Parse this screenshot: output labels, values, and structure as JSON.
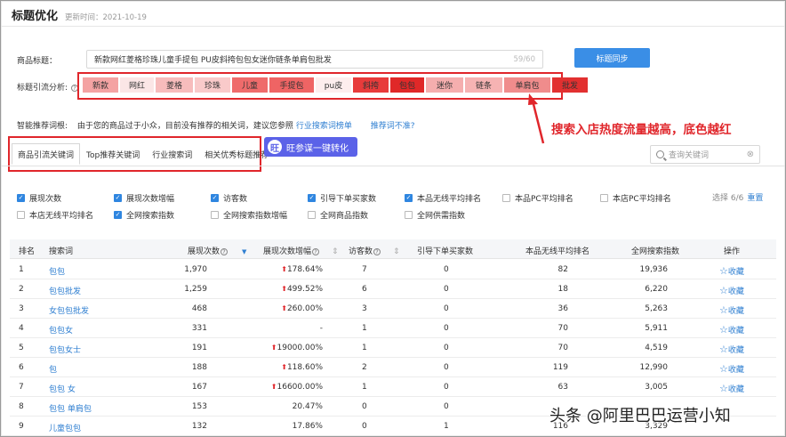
{
  "header": {
    "title": "标题优化",
    "updated": "更新时间：2021-10-19"
  },
  "title_row": {
    "label": "商品标题：",
    "value": "新款网红菱格珍珠儿童手提包 PU皮斜挎包包女迷你链条单肩包批发",
    "count": "59/60",
    "sync_button": "标题同步"
  },
  "traffic": {
    "label": "标题引流分析:",
    "help_icon": "question-circle-icon",
    "tokens": [
      {
        "text": "新款",
        "color": "#f4a3a3"
      },
      {
        "text": "网红",
        "color": "#fbe6e6"
      },
      {
        "text": "菱格",
        "color": "#f7bcbc"
      },
      {
        "text": "珍珠",
        "color": "#f9caca"
      },
      {
        "text": "儿童",
        "color": "#ef6b6b"
      },
      {
        "text": "手提包",
        "color": "#ef6464"
      },
      {
        "text": "pu皮",
        "color": "#fdeeee"
      },
      {
        "text": "斜挎",
        "color": "#e83b3b"
      },
      {
        "text": "包包",
        "color": "#e02828"
      },
      {
        "text": "迷你",
        "color": "#f5aeae"
      },
      {
        "text": "链条",
        "color": "#f6b3b3"
      },
      {
        "text": "单肩包",
        "color": "#f08c8c"
      },
      {
        "text": "批发",
        "color": "#e23030"
      }
    ]
  },
  "recommend": {
    "label": "智能推荐词根:",
    "note": "由于您的商品过于小众，目前没有推荐的相关词，建议您参照",
    "link": "行业搜索词榜单",
    "link2": "推荐词不准?"
  },
  "annotation": "搜索入店热度流量越高，底色越红",
  "tabs": [
    "商品引流关键词",
    "Top推荐关键词",
    "行业搜索词",
    "相关优秀标题推荐"
  ],
  "wang_button": "旺参谋一键转化",
  "search": {
    "placeholder": "查询关键词"
  },
  "checkboxes": [
    {
      "label": "展现次数",
      "checked": true
    },
    {
      "label": "展现次数增幅",
      "checked": true
    },
    {
      "label": "访客数",
      "checked": true
    },
    {
      "label": "引导下单买家数",
      "checked": true
    },
    {
      "label": "本品无线平均排名",
      "checked": true
    },
    {
      "label": "本品PC平均排名",
      "checked": false
    },
    {
      "label": "本店PC平均排名",
      "checked": false
    },
    {
      "label": "本店无线平均排名",
      "checked": false
    },
    {
      "label": "全网搜索指数",
      "checked": true
    },
    {
      "label": "全网搜索指数增幅",
      "checked": false
    },
    {
      "label": "全网商品指数",
      "checked": false
    },
    {
      "label": "全网供需指数",
      "checked": false
    }
  ],
  "selection": {
    "text": "选择 6/6",
    "reset": "重置"
  },
  "table": {
    "headers": [
      "排名",
      "搜索词",
      "展现次数",
      "展现次数增幅",
      "访客数",
      "引导下单买家数",
      "本品无线平均排名",
      "全网搜索指数",
      "操作"
    ],
    "rows": [
      {
        "rank": "1",
        "kw": "包包",
        "imp": "1,970",
        "growth": "178.64%",
        "up": true,
        "visitors": "7",
        "buyers": "0",
        "mrank": "82",
        "index": "19,936",
        "op": "收藏"
      },
      {
        "rank": "2",
        "kw": "包包批发",
        "imp": "1,259",
        "growth": "499.52%",
        "up": true,
        "visitors": "6",
        "buyers": "0",
        "mrank": "18",
        "index": "6,220",
        "op": "收藏"
      },
      {
        "rank": "3",
        "kw": "女包包批发",
        "imp": "468",
        "growth": "260.00%",
        "up": true,
        "visitors": "3",
        "buyers": "0",
        "mrank": "36",
        "index": "5,263",
        "op": "收藏"
      },
      {
        "rank": "4",
        "kw": "包包女",
        "imp": "331",
        "growth": "-",
        "up": false,
        "visitors": "1",
        "buyers": "0",
        "mrank": "70",
        "index": "5,911",
        "op": "收藏"
      },
      {
        "rank": "5",
        "kw": "包包女士",
        "imp": "191",
        "growth": "19000.00%",
        "up": true,
        "visitors": "1",
        "buyers": "0",
        "mrank": "70",
        "index": "4,519",
        "op": "收藏"
      },
      {
        "rank": "6",
        "kw": "包",
        "imp": "188",
        "growth": "118.60%",
        "up": true,
        "visitors": "2",
        "buyers": "0",
        "mrank": "119",
        "index": "12,990",
        "op": "收藏"
      },
      {
        "rank": "7",
        "kw": "包包 女",
        "imp": "167",
        "growth": "16600.00%",
        "up": true,
        "visitors": "1",
        "buyers": "0",
        "mrank": "63",
        "index": "3,005",
        "op": "收藏"
      },
      {
        "rank": "8",
        "kw": "包包 单肩包",
        "imp": "153",
        "growth": "20.47%",
        "up": false,
        "visitors": "0",
        "buyers": "0",
        "mrank": "",
        "index": "",
        "op": ""
      },
      {
        "rank": "9",
        "kw": "儿童包包",
        "imp": "132",
        "growth": "17.86%",
        "up": false,
        "visitors": "0",
        "buyers": "1",
        "mrank": "116",
        "index": "3,329",
        "op": ""
      }
    ]
  },
  "watermark": "头条 @阿里巴巴运营小知"
}
